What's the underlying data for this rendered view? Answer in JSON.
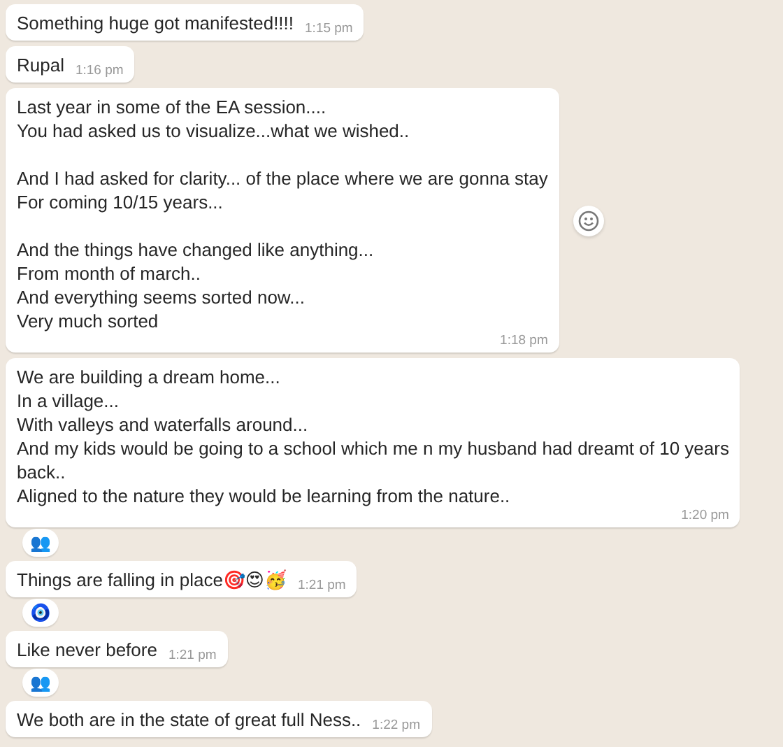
{
  "messages": [
    {
      "paragraphs": [
        [
          "Something huge got manifested!!!!"
        ]
      ],
      "time": "1:15 pm"
    },
    {
      "paragraphs": [
        [
          "Rupal"
        ]
      ],
      "time": "1:16 pm"
    },
    {
      "paragraphs": [
        [
          "Last year in some of the EA session....",
          "You had asked us to visualize...what we wished.."
        ],
        [
          "And I had asked for clarity... of the place where we are gonna stay",
          "For coming 10/15 years..."
        ],
        [
          "And the things have changed like anything...",
          "From month of march..",
          "And everything seems sorted now...",
          "Very much sorted"
        ]
      ],
      "time": "1:18 pm",
      "react_button": true
    },
    {
      "paragraphs": [
        [
          "We are building a dream home...",
          "In a village...",
          "With valleys and waterfalls around...",
          "And my kids would be going to a school which me n my husband had dreamt of 10 years",
          "back..",
          "Aligned to the nature they would be learning from the nature.."
        ]
      ],
      "time": "1:20 pm",
      "reaction": "👥"
    },
    {
      "paragraphs": [
        [
          "Things are falling in place🎯😍🥳"
        ]
      ],
      "time": "1:21 pm",
      "reaction": "🧿"
    },
    {
      "paragraphs": [
        [
          "Like never before"
        ]
      ],
      "time": "1:21 pm",
      "reaction": "👥"
    },
    {
      "paragraphs": [
        [
          "We both are in the state of great full Ness.."
        ]
      ],
      "time": "1:22 pm"
    }
  ]
}
